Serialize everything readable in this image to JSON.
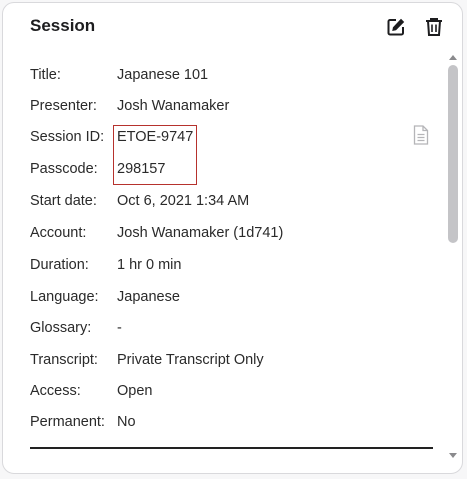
{
  "panel": {
    "title": "Session"
  },
  "icons": {
    "edit": "edit-icon",
    "delete": "trash-icon",
    "document": "document-icon"
  },
  "colors": {
    "highlight_border": "#b6322d",
    "scrollbar_thumb": "#c4c4c7"
  },
  "fields": [
    {
      "label": "Title:",
      "value": "Japanese 101"
    },
    {
      "label": "Presenter:",
      "value": "Josh Wanamaker"
    },
    {
      "label": "Session ID:",
      "value": "ETOE-9747"
    },
    {
      "label": "Passcode:",
      "value": "298157"
    },
    {
      "label": "Start date:",
      "value": "Oct 6, 2021 1:34 AM"
    },
    {
      "label": "Account:",
      "value": "Josh Wanamaker (1d741)"
    },
    {
      "label": "Duration:",
      "value": "1 hr 0 min"
    },
    {
      "label": "Language:",
      "value": "Japanese"
    },
    {
      "label": "Glossary:",
      "value": "-"
    },
    {
      "label": "Transcript:",
      "value": "Private Transcript Only"
    },
    {
      "label": "Access:",
      "value": "Open"
    },
    {
      "label": "Permanent:",
      "value": "No"
    }
  ]
}
